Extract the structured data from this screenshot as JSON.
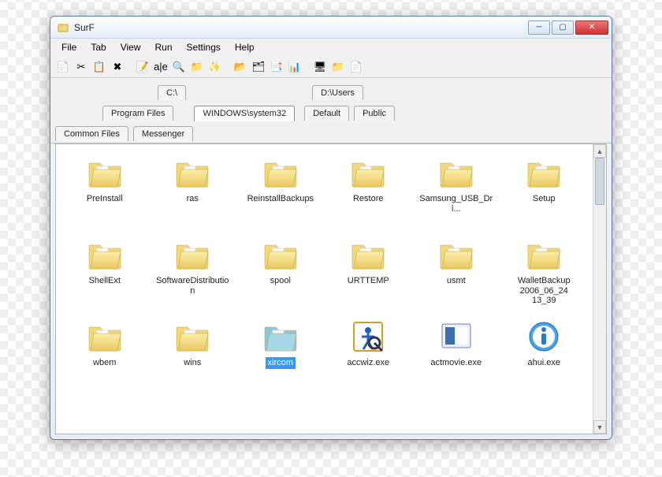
{
  "window": {
    "title": "SurF"
  },
  "menu": {
    "items": [
      "File",
      "Tab",
      "View",
      "Run",
      "Settings",
      "Help"
    ]
  },
  "toolbar": {
    "buttons": [
      "copy",
      "cut",
      "paste",
      "delete",
      "properties",
      "rename",
      "find",
      "new-folder",
      "refresh",
      "up",
      "icons-view",
      "list-view",
      "details-view",
      "tree",
      "shell",
      "options",
      "help"
    ]
  },
  "tabs": {
    "row1": [
      {
        "label": "C:\\",
        "selected": false
      },
      {
        "label": "D:\\Users",
        "selected": false
      }
    ],
    "row2": [
      {
        "label": "Program Files",
        "selected": false
      },
      {
        "label": "WINDOWS\\system32",
        "selected": true
      },
      {
        "label": "Default",
        "selected": false
      },
      {
        "label": "Public",
        "selected": false
      }
    ],
    "row3": [
      {
        "label": "Common Files",
        "selected": false
      },
      {
        "label": "Messenger",
        "selected": false
      }
    ]
  },
  "files": [
    {
      "name": "PreInstall",
      "type": "folder"
    },
    {
      "name": "ras",
      "type": "folder"
    },
    {
      "name": "ReinstallBackups",
      "type": "folder"
    },
    {
      "name": "Restore",
      "type": "folder"
    },
    {
      "name": "Samsung_USB_Dri...",
      "type": "folder"
    },
    {
      "name": "Setup",
      "type": "folder"
    },
    {
      "name": "ShellExt",
      "type": "folder"
    },
    {
      "name": "SoftwareDistribution",
      "type": "folder"
    },
    {
      "name": "spool",
      "type": "folder"
    },
    {
      "name": "URTTEMP",
      "type": "folder"
    },
    {
      "name": "usmt",
      "type": "folder"
    },
    {
      "name": "WalletBackup 2006_06_24 13_39",
      "type": "folder"
    },
    {
      "name": "wbem",
      "type": "folder"
    },
    {
      "name": "wins",
      "type": "folder"
    },
    {
      "name": "xircom",
      "type": "folder-blue",
      "selected": true
    },
    {
      "name": "accwiz.exe",
      "type": "exe-accwiz"
    },
    {
      "name": "actmovie.exe",
      "type": "exe-actmovie"
    },
    {
      "name": "ahui.exe",
      "type": "exe-info"
    }
  ]
}
